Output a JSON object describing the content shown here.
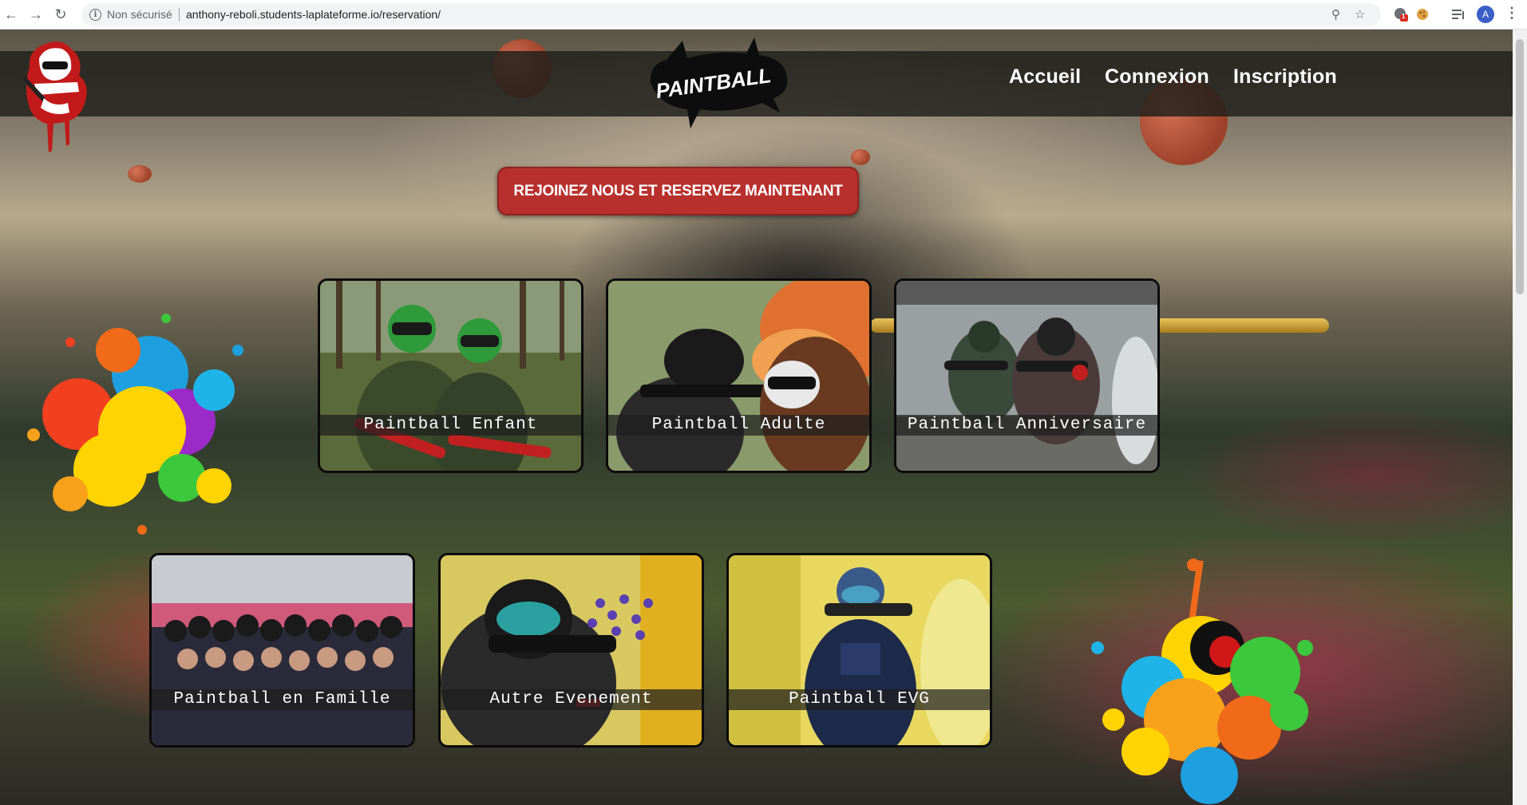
{
  "browser": {
    "security_label": "Non sécurisé",
    "url": "anthony-reboli.students-laplateforme.io/reservation/",
    "avatar_letter": "A",
    "extension_badge": "1"
  },
  "nav": {
    "items": [
      "Accueil",
      "Connexion",
      "Inscription"
    ]
  },
  "brand": {
    "logo_text": "PAINTBALL"
  },
  "cta": {
    "label": "REJOINEZ NOUS ET RESERVEZ MAINTENANT"
  },
  "cards": [
    {
      "label": "Paintball Enfant"
    },
    {
      "label": "Paintball Adulte"
    },
    {
      "label": "Paintball Anniversaire"
    },
    {
      "label": "Paintball en Famille"
    },
    {
      "label": "Autre Evenement"
    },
    {
      "label": "Paintball EVG"
    }
  ],
  "colors": {
    "cta_bg": "#b8302d",
    "navbar_bg": "#1e1e1a",
    "card_border": "#0b0b0b"
  }
}
